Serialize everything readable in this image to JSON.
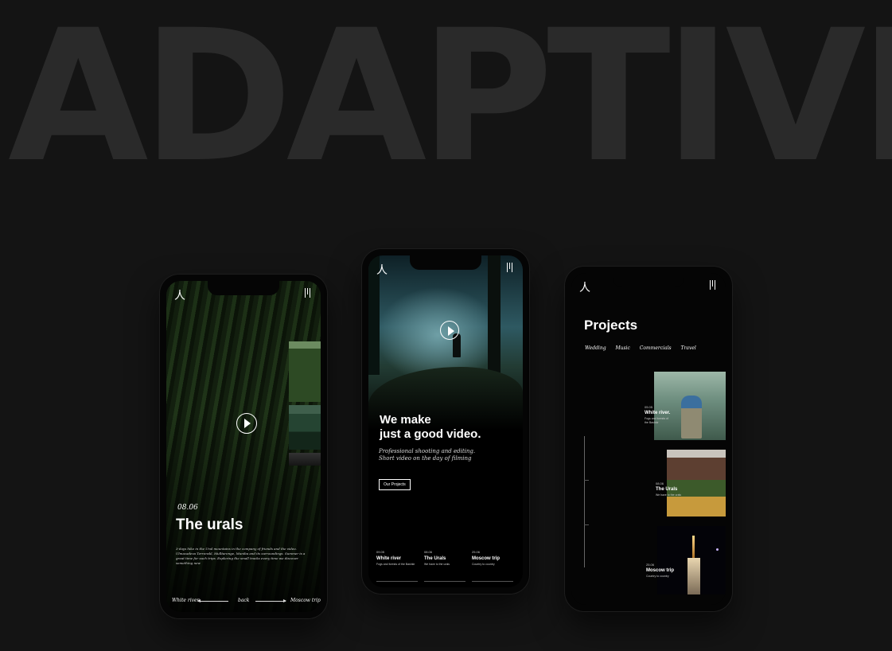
{
  "hero": {
    "text": "ADAPTIVE"
  },
  "brand": {
    "logo_glyph": "人"
  },
  "phone1": {
    "date": "08.06",
    "title": "The urals",
    "description": "3-days hike in the Ural mountains in the company of friends and the video. Ulmacadeva Terrenskl, Mulltarenge, Muniba and its surroundings. Summer is a great time for such trips. Exploring the small tracks every time we discover something new",
    "nav": {
      "prev": "White river",
      "center": "back",
      "next": "Moscow trip"
    }
  },
  "phone2": {
    "headline_line1": "We make",
    "headline_line2": "just a good video.",
    "sub_line1": "Professional shooting and editing.",
    "sub_line2": "Short video on the day of filming",
    "cta": "Our Projects",
    "cards": [
      {
        "date": "09.05",
        "name": "White river",
        "sub": "Fogs and forests of the Bashkir"
      },
      {
        "date": "08.06",
        "name": "The Urals",
        "sub": "We have to the urals"
      },
      {
        "date": "25.06",
        "name": "Moscow trip",
        "sub": "Country to country"
      }
    ]
  },
  "phone3": {
    "title": "Projects",
    "categories": [
      "Wedding",
      "Music",
      "Commercials",
      "Travel"
    ],
    "projects": [
      {
        "date": "05.05",
        "name": "White river.",
        "sub": "Fogs and forests of the Bashkir"
      },
      {
        "date": "08.06",
        "name": "The Urals",
        "sub": "We have to the urals"
      },
      {
        "date": "25.06",
        "name": "Moscow trip",
        "sub": "Country to country"
      }
    ]
  }
}
